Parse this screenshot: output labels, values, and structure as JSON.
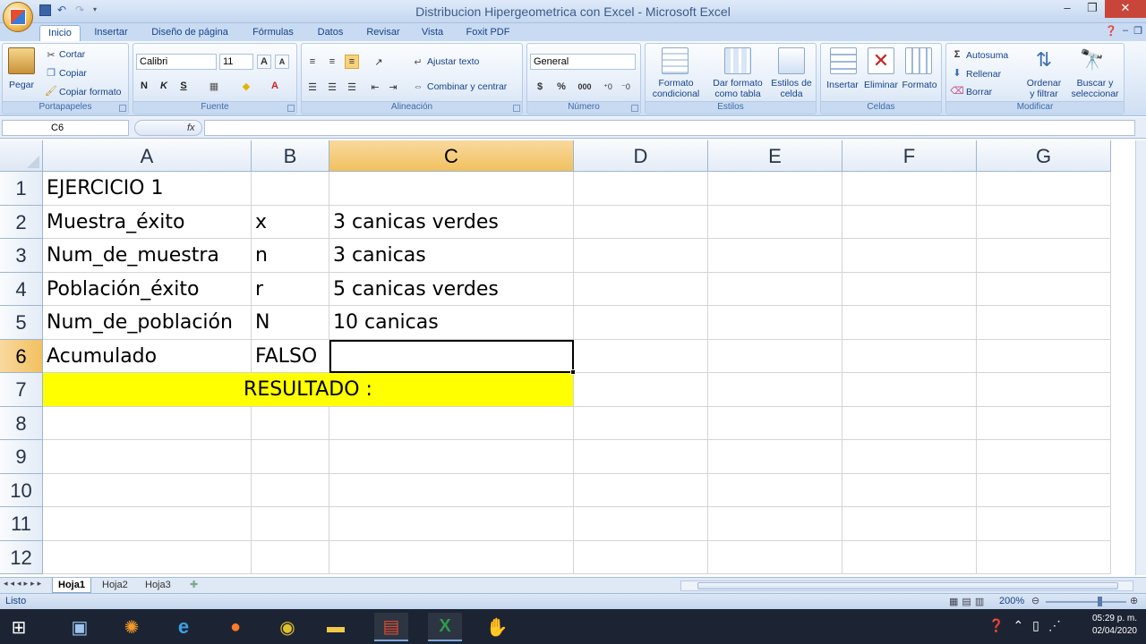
{
  "window": {
    "title": "Distribucion Hipergeometrica con Excel - Microsoft Excel"
  },
  "tabs": [
    "Inicio",
    "Insertar",
    "Diseño de página",
    "Fórmulas",
    "Datos",
    "Revisar",
    "Vista",
    "Foxit PDF"
  ],
  "ribbon": {
    "clipboard": {
      "label": "Portapapeles",
      "paste": "Pegar",
      "cut": "Cortar",
      "copy": "Copiar",
      "format_painter": "Copiar formato"
    },
    "font": {
      "label": "Fuente",
      "name": "Calibri",
      "size": "11"
    },
    "alignment": {
      "label": "Alineación",
      "wrap": "Ajustar texto",
      "merge": "Combinar y centrar"
    },
    "number": {
      "label": "Número",
      "format": "General"
    },
    "styles": {
      "label": "Estilos",
      "cond1": "Formato",
      "cond2": "condicional",
      "table1": "Dar formato",
      "table2": "como tabla",
      "cell1": "Estilos de",
      "cell2": "celda"
    },
    "cells": {
      "label": "Celdas",
      "insert": "Insertar",
      "delete": "Eliminar",
      "format": "Formato"
    },
    "editing": {
      "label": "Modificar",
      "autosum": "Autosuma",
      "fill": "Rellenar",
      "clear": "Borrar",
      "sort1": "Ordenar",
      "sort2": "y filtrar",
      "find1": "Buscar y",
      "find2": "seleccionar"
    }
  },
  "formula_bar": {
    "name_box": "C6",
    "fx": "fx",
    "value": ""
  },
  "columns": [
    "A",
    "B",
    "C",
    "D",
    "E",
    "F",
    "G"
  ],
  "rows": [
    "1",
    "2",
    "3",
    "4",
    "5",
    "6",
    "7",
    "8",
    "9",
    "10",
    "11",
    "12"
  ],
  "cells": {
    "A1": "EJERCICIO 1",
    "A2": "Muestra_éxito",
    "B2": "x",
    "C2": "3 canicas verdes",
    "A3": "Num_de_muestra",
    "B3": "n",
    "C3": "3 canicas",
    "A4": "Población_éxito",
    "B4": "r",
    "C4": "5 canicas verdes",
    "A5": "Num_de_población",
    "B5": "N",
    "C5": "10 canicas",
    "A6": "Acumulado",
    "B6": "FALSO",
    "A7": "RESULTADO :"
  },
  "sheets": [
    "Hoja1",
    "Hoja2",
    "Hoja3"
  ],
  "status": {
    "ready": "Listo",
    "zoom": "200%"
  },
  "clock": {
    "time": "05:29 p. m.",
    "date": "02/04/2020"
  },
  "colors": {
    "highlight": "#ffff00",
    "selected_header": "#f1c15f"
  }
}
